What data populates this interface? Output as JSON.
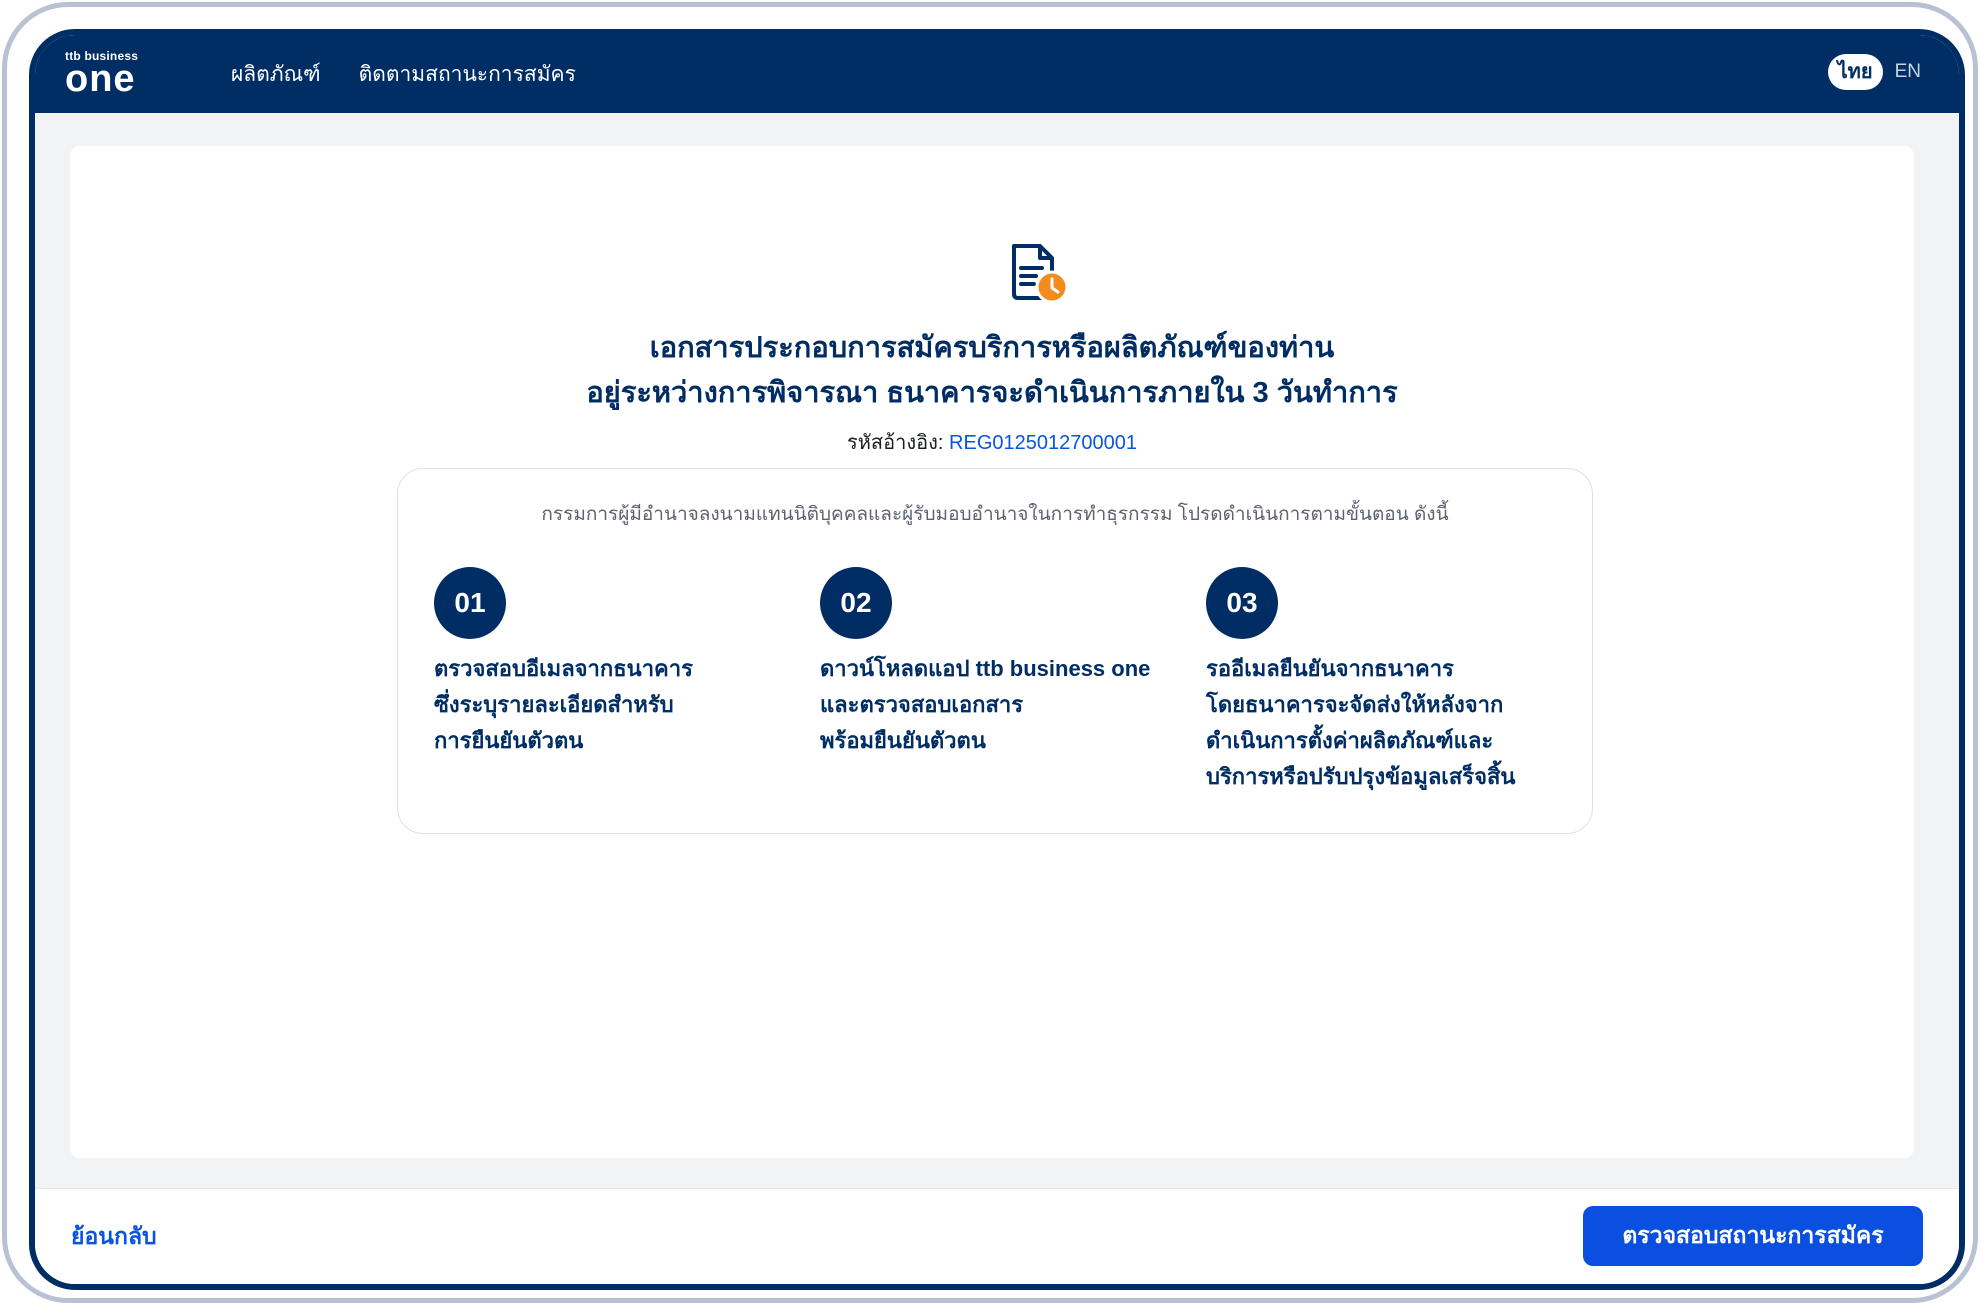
{
  "brand": {
    "small": "ttb business",
    "big": "one"
  },
  "nav": {
    "products": "ผลิตภัณฑ์",
    "track_status": "ติดตามสถานะการสมัคร"
  },
  "lang": {
    "th": "ไทย",
    "en": "EN"
  },
  "main": {
    "icon": "document-clock-icon",
    "headline_line1": "เอกสารประกอบการสมัครบริการหรือผลิตภัณฑ์ของท่าน",
    "headline_line2": "อยู่ระหว่างการพิจารณา ธนาคารจะดำเนินการภายใน 3 วันทำการ",
    "ref_label": "รหัสอ้างอิง:",
    "ref_code": "REG0125012700001"
  },
  "steps": {
    "intro": "กรรมการผู้มีอำนาจลงนามแทนนิติบุคคลและผู้รับมอบอำนาจในการทำธุรกรรม โปรดดำเนินการตามขั้นตอน ดังนี้",
    "items": [
      {
        "num": "01",
        "lines": [
          "ตรวจสอบอีเมลจากธนาคาร",
          "ซึ่งระบุรายละเอียดสำหรับ",
          "การยืนยันตัวตน"
        ]
      },
      {
        "num": "02",
        "lines": [
          "ดาวน์โหลดแอป ttb business one",
          "และตรวจสอบเอกสาร",
          "พร้อมยืนยันตัวตน"
        ]
      },
      {
        "num": "03",
        "lines": [
          "รออีเมลยืนยันจากธนาคาร",
          "โดยธนาคารจะจัดส่งให้หลังจาก",
          "ดำเนินการตั้งค่าผลิตภัณฑ์และ",
          "บริการหรือปรับปรุงข้อมูลเสร็จสิ้น"
        ]
      }
    ]
  },
  "footer": {
    "back": "ย้อนกลับ",
    "check_status": "ตรวจสอบสถานะการสมัคร"
  },
  "colors": {
    "navy": "#002d63",
    "blue": "#0a4fe0",
    "orange": "#f28c1e"
  }
}
